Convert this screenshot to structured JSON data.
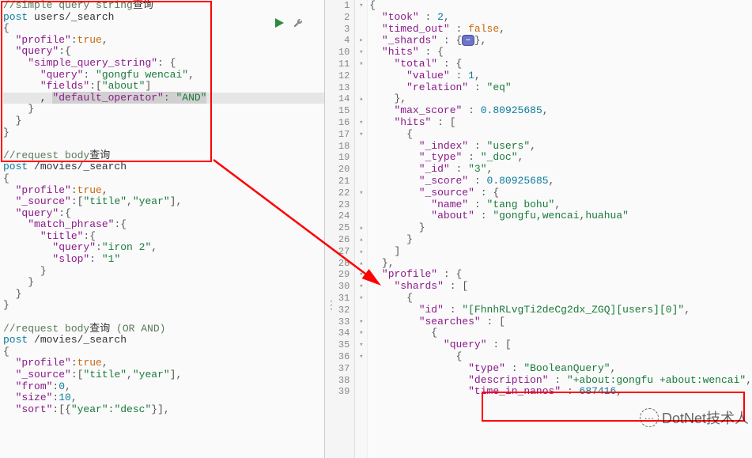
{
  "left": {
    "lines": [
      [
        [
          "comment",
          "//simple query string"
        ],
        [
          "cjk",
          "查询"
        ]
      ],
      [
        [
          "kw",
          "post"
        ],
        [
          "txt",
          " users/_search"
        ]
      ],
      [
        [
          "punct",
          "{"
        ]
      ],
      [
        [
          "txt",
          "  "
        ],
        [
          "key",
          "\"profile\""
        ],
        [
          "punct",
          ":"
        ],
        [
          "bool",
          "true"
        ],
        [
          "punct",
          ","
        ]
      ],
      [
        [
          "txt",
          "  "
        ],
        [
          "key",
          "\"query\""
        ],
        [
          "punct",
          ":{"
        ]
      ],
      [
        [
          "txt",
          "    "
        ],
        [
          "key",
          "\"simple_query_string\""
        ],
        [
          "punct",
          ": {"
        ]
      ],
      [
        [
          "txt",
          "      "
        ],
        [
          "key",
          "\"query\""
        ],
        [
          "punct",
          ": "
        ],
        [
          "str",
          "\"gongfu wencai\""
        ],
        [
          "punct",
          ","
        ]
      ],
      [
        [
          "txt",
          "      "
        ],
        [
          "key",
          "\"fields\""
        ],
        [
          "punct",
          ":["
        ],
        [
          "str",
          "\"about\""
        ],
        [
          "punct",
          "]"
        ]
      ],
      [
        [
          "txt",
          "      , "
        ],
        [
          "key",
          "\"default_operator\""
        ],
        [
          "punct",
          ": "
        ],
        [
          "str",
          "\"AND\""
        ]
      ],
      [
        [
          "txt",
          "    "
        ],
        [
          "punct",
          "}"
        ]
      ],
      [
        [
          "txt",
          "  "
        ],
        [
          "punct",
          "}"
        ]
      ],
      [
        [
          "punct",
          "}"
        ]
      ],
      [
        [
          "txt",
          ""
        ]
      ],
      [
        [
          "comment",
          "//request body"
        ],
        [
          "cjk",
          "查询"
        ]
      ],
      [
        [
          "kw",
          "post"
        ],
        [
          "txt",
          " /movies/_search"
        ]
      ],
      [
        [
          "punct",
          "{"
        ]
      ],
      [
        [
          "txt",
          "  "
        ],
        [
          "key",
          "\"profile\""
        ],
        [
          "punct",
          ":"
        ],
        [
          "bool",
          "true"
        ],
        [
          "punct",
          ","
        ]
      ],
      [
        [
          "txt",
          "  "
        ],
        [
          "key",
          "\"_source\""
        ],
        [
          "punct",
          ":["
        ],
        [
          "str",
          "\"title\""
        ],
        [
          "punct",
          ","
        ],
        [
          "str",
          "\"year\""
        ],
        [
          "punct",
          "],"
        ]
      ],
      [
        [
          "txt",
          "  "
        ],
        [
          "key",
          "\"query\""
        ],
        [
          "punct",
          ":{"
        ]
      ],
      [
        [
          "txt",
          "    "
        ],
        [
          "key",
          "\"match_phrase\""
        ],
        [
          "punct",
          ":{"
        ]
      ],
      [
        [
          "txt",
          "      "
        ],
        [
          "key",
          "\"title\""
        ],
        [
          "punct",
          ":{"
        ]
      ],
      [
        [
          "txt",
          "        "
        ],
        [
          "key",
          "\"query\""
        ],
        [
          "punct",
          ":"
        ],
        [
          "str",
          "\"iron 2\""
        ],
        [
          "punct",
          ","
        ]
      ],
      [
        [
          "txt",
          "        "
        ],
        [
          "key",
          "\"slop\""
        ],
        [
          "punct",
          ": "
        ],
        [
          "str",
          "\"1\""
        ]
      ],
      [
        [
          "txt",
          "      "
        ],
        [
          "punct",
          "}"
        ]
      ],
      [
        [
          "txt",
          "    "
        ],
        [
          "punct",
          "}"
        ]
      ],
      [
        [
          "txt",
          "  "
        ],
        [
          "punct",
          "}"
        ]
      ],
      [
        [
          "punct",
          "}"
        ]
      ],
      [
        [
          "txt",
          ""
        ]
      ],
      [
        [
          "comment",
          "//request body"
        ],
        [
          "cjk",
          "查询 "
        ],
        [
          "comment",
          "(OR AND)"
        ]
      ],
      [
        [
          "kw",
          "post"
        ],
        [
          "txt",
          " /movies/_search"
        ]
      ],
      [
        [
          "punct",
          "{"
        ]
      ],
      [
        [
          "txt",
          "  "
        ],
        [
          "key",
          "\"profile\""
        ],
        [
          "punct",
          ":"
        ],
        [
          "bool",
          "true"
        ],
        [
          "punct",
          ","
        ]
      ],
      [
        [
          "txt",
          "  "
        ],
        [
          "key",
          "\"_source\""
        ],
        [
          "punct",
          ":["
        ],
        [
          "str",
          "\"title\""
        ],
        [
          "punct",
          ","
        ],
        [
          "str",
          "\"year\""
        ],
        [
          "punct",
          "],"
        ]
      ],
      [
        [
          "txt",
          "  "
        ],
        [
          "key",
          "\"from\""
        ],
        [
          "punct",
          ":"
        ],
        [
          "num",
          "0"
        ],
        [
          "punct",
          ","
        ]
      ],
      [
        [
          "txt",
          "  "
        ],
        [
          "key",
          "\"size\""
        ],
        [
          "punct",
          ":"
        ],
        [
          "num",
          "10"
        ],
        [
          "punct",
          ","
        ]
      ],
      [
        [
          "txt",
          "  "
        ],
        [
          "key",
          "\"sort\""
        ],
        [
          "punct",
          ":[{"
        ],
        [
          "str",
          "\"year\""
        ],
        [
          "punct",
          ":"
        ],
        [
          "str",
          "\"desc\""
        ],
        [
          "punct",
          "}],"
        ]
      ]
    ],
    "highlight_line_index": 8
  },
  "right": {
    "start_line": 1,
    "lines": [
      {
        "ln": "1",
        "fold": "-",
        "tokens": [
          [
            "punct",
            "{"
          ]
        ]
      },
      {
        "ln": "2",
        "fold": "",
        "tokens": [
          [
            "txt",
            "  "
          ],
          [
            "key",
            "\"took\""
          ],
          [
            "punct",
            " : "
          ],
          [
            "num",
            "2"
          ],
          [
            "punct",
            ","
          ]
        ]
      },
      {
        "ln": "3",
        "fold": "",
        "tokens": [
          [
            "txt",
            "  "
          ],
          [
            "key",
            "\"timed_out\""
          ],
          [
            "punct",
            " : "
          ],
          [
            "bool",
            "false"
          ],
          [
            "punct",
            ","
          ]
        ]
      },
      {
        "ln": "4",
        "fold": "+",
        "tokens": [
          [
            "txt",
            "  "
          ],
          [
            "key",
            "\"_shards\""
          ],
          [
            "punct",
            " : {"
          ],
          [
            "badge",
            "⋯"
          ],
          [
            "punct",
            "},"
          ]
        ]
      },
      {
        "ln": "10",
        "fold": "-",
        "tokens": [
          [
            "txt",
            "  "
          ],
          [
            "key",
            "\"hits\""
          ],
          [
            "punct",
            " : {"
          ]
        ]
      },
      {
        "ln": "11",
        "fold": "-",
        "tokens": [
          [
            "txt",
            "    "
          ],
          [
            "key",
            "\"total\""
          ],
          [
            "punct",
            " : {"
          ]
        ]
      },
      {
        "ln": "12",
        "fold": "",
        "tokens": [
          [
            "txt",
            "      "
          ],
          [
            "key",
            "\"value\""
          ],
          [
            "punct",
            " : "
          ],
          [
            "num",
            "1"
          ],
          [
            "punct",
            ","
          ]
        ]
      },
      {
        "ln": "13",
        "fold": "",
        "tokens": [
          [
            "txt",
            "      "
          ],
          [
            "key",
            "\"relation\""
          ],
          [
            "punct",
            " : "
          ],
          [
            "str",
            "\"eq\""
          ]
        ]
      },
      {
        "ln": "14",
        "fold": "^",
        "tokens": [
          [
            "txt",
            "    "
          ],
          [
            "punct",
            "},"
          ]
        ]
      },
      {
        "ln": "15",
        "fold": "",
        "tokens": [
          [
            "txt",
            "    "
          ],
          [
            "key",
            "\"max_score\""
          ],
          [
            "punct",
            " : "
          ],
          [
            "num",
            "0.80925685"
          ],
          [
            "punct",
            ","
          ]
        ]
      },
      {
        "ln": "16",
        "fold": "-",
        "tokens": [
          [
            "txt",
            "    "
          ],
          [
            "key",
            "\"hits\""
          ],
          [
            "punct",
            " : ["
          ]
        ]
      },
      {
        "ln": "17",
        "fold": "-",
        "tokens": [
          [
            "txt",
            "      "
          ],
          [
            "punct",
            "{"
          ]
        ]
      },
      {
        "ln": "18",
        "fold": "",
        "tokens": [
          [
            "txt",
            "        "
          ],
          [
            "key",
            "\"_index\""
          ],
          [
            "punct",
            " : "
          ],
          [
            "str",
            "\"users\""
          ],
          [
            "punct",
            ","
          ]
        ]
      },
      {
        "ln": "19",
        "fold": "",
        "tokens": [
          [
            "txt",
            "        "
          ],
          [
            "key",
            "\"_type\""
          ],
          [
            "punct",
            " : "
          ],
          [
            "str",
            "\"_doc\""
          ],
          [
            "punct",
            ","
          ]
        ]
      },
      {
        "ln": "20",
        "fold": "",
        "tokens": [
          [
            "txt",
            "        "
          ],
          [
            "key",
            "\"_id\""
          ],
          [
            "punct",
            " : "
          ],
          [
            "str",
            "\"3\""
          ],
          [
            "punct",
            ","
          ]
        ]
      },
      {
        "ln": "21",
        "fold": "",
        "tokens": [
          [
            "txt",
            "        "
          ],
          [
            "key",
            "\"_score\""
          ],
          [
            "punct",
            " : "
          ],
          [
            "num",
            "0.80925685"
          ],
          [
            "punct",
            ","
          ]
        ]
      },
      {
        "ln": "22",
        "fold": "-",
        "tokens": [
          [
            "txt",
            "        "
          ],
          [
            "key",
            "\"_source\""
          ],
          [
            "punct",
            " : {"
          ]
        ]
      },
      {
        "ln": "23",
        "fold": "",
        "tokens": [
          [
            "txt",
            "          "
          ],
          [
            "key",
            "\"name\""
          ],
          [
            "punct",
            " : "
          ],
          [
            "str",
            "\"tang bohu\""
          ],
          [
            "punct",
            ","
          ]
        ]
      },
      {
        "ln": "24",
        "fold": "",
        "tokens": [
          [
            "txt",
            "          "
          ],
          [
            "key",
            "\"about\""
          ],
          [
            "punct",
            " : "
          ],
          [
            "str",
            "\"gongfu,wencai,huahua\""
          ]
        ]
      },
      {
        "ln": "25",
        "fold": "^",
        "tokens": [
          [
            "txt",
            "        "
          ],
          [
            "punct",
            "}"
          ]
        ]
      },
      {
        "ln": "26",
        "fold": "^",
        "tokens": [
          [
            "txt",
            "      "
          ],
          [
            "punct",
            "}"
          ]
        ]
      },
      {
        "ln": "27",
        "fold": "^",
        "tokens": [
          [
            "txt",
            "    "
          ],
          [
            "punct",
            "]"
          ]
        ]
      },
      {
        "ln": "28",
        "fold": "^",
        "tokens": [
          [
            "txt",
            "  "
          ],
          [
            "punct",
            "},"
          ]
        ]
      },
      {
        "ln": "29",
        "fold": "-",
        "tokens": [
          [
            "txt",
            "  "
          ],
          [
            "key",
            "\"profile\""
          ],
          [
            "punct",
            " : {"
          ]
        ]
      },
      {
        "ln": "30",
        "fold": "-",
        "tokens": [
          [
            "txt",
            "    "
          ],
          [
            "key",
            "\"shards\""
          ],
          [
            "punct",
            " : ["
          ]
        ]
      },
      {
        "ln": "31",
        "fold": "-",
        "tokens": [
          [
            "txt",
            "      "
          ],
          [
            "punct",
            "{"
          ]
        ]
      },
      {
        "ln": "32",
        "fold": "",
        "tokens": [
          [
            "txt",
            "        "
          ],
          [
            "key",
            "\"id\""
          ],
          [
            "punct",
            " : "
          ],
          [
            "str",
            "\"[FhnhRLvgTi2deCg2dx_ZGQ][users][0]\""
          ],
          [
            "punct",
            ","
          ]
        ]
      },
      {
        "ln": "33",
        "fold": "-",
        "tokens": [
          [
            "txt",
            "        "
          ],
          [
            "key",
            "\"searches\""
          ],
          [
            "punct",
            " : ["
          ]
        ]
      },
      {
        "ln": "34",
        "fold": "-",
        "tokens": [
          [
            "txt",
            "          "
          ],
          [
            "punct",
            "{"
          ]
        ]
      },
      {
        "ln": "35",
        "fold": "-",
        "tokens": [
          [
            "txt",
            "            "
          ],
          [
            "key",
            "\"query\""
          ],
          [
            "punct",
            " : ["
          ]
        ]
      },
      {
        "ln": "36",
        "fold": "-",
        "tokens": [
          [
            "txt",
            "              "
          ],
          [
            "punct",
            "{"
          ]
        ]
      },
      {
        "ln": "37",
        "fold": "",
        "tokens": [
          [
            "txt",
            "                "
          ],
          [
            "key",
            "\"type\""
          ],
          [
            "punct",
            " : "
          ],
          [
            "str",
            "\"BooleanQuery\""
          ],
          [
            "punct",
            ","
          ]
        ]
      },
      {
        "ln": "38",
        "fold": "",
        "tokens": [
          [
            "txt",
            "                "
          ],
          [
            "key",
            "\"description\""
          ],
          [
            "punct",
            " : "
          ],
          [
            "str",
            "\"+about:gongfu +about:wencai\""
          ],
          [
            "punct",
            ","
          ]
        ]
      },
      {
        "ln": "39",
        "fold": "",
        "tokens": [
          [
            "txt",
            "                "
          ],
          [
            "key",
            "\"time_in_nanos\""
          ],
          [
            "punct",
            " : "
          ],
          [
            "num",
            "687416"
          ],
          [
            "punct",
            ","
          ]
        ]
      }
    ]
  },
  "icons": {
    "play": "play-icon",
    "wrench": "wrench-icon"
  },
  "watermark": "DotNet技术人"
}
